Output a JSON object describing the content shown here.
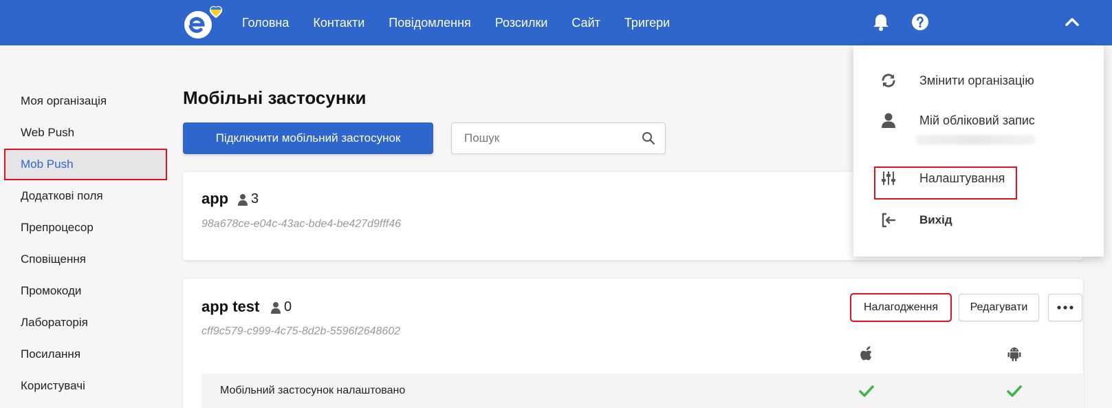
{
  "colors": {
    "primary": "#2f66cc",
    "highlight": "#e0111b",
    "success": "#3cb54a"
  },
  "header": {
    "logo_icon": "e-logo-heart-icon",
    "nav": [
      {
        "label": "Головна"
      },
      {
        "label": "Контакти"
      },
      {
        "label": "Повідомлення"
      },
      {
        "label": "Розсилки"
      },
      {
        "label": "Сайт"
      },
      {
        "label": "Тригери"
      }
    ],
    "icons": [
      "bell-icon",
      "help-icon",
      "chevron-up-icon"
    ]
  },
  "sidebar": {
    "items": [
      {
        "label": "Моя організація"
      },
      {
        "label": "Web Push"
      },
      {
        "label": "Mob Push"
      },
      {
        "label": "Додаткові поля"
      },
      {
        "label": "Препроцесор"
      },
      {
        "label": "Сповіщення"
      },
      {
        "label": "Промокоди"
      },
      {
        "label": "Лабораторія"
      },
      {
        "label": "Посилання"
      },
      {
        "label": "Користувачі"
      }
    ],
    "active": "Mob Push"
  },
  "main": {
    "title": "Мобільні застосунки",
    "connect_button": "Підключити мобільний застосунок",
    "search": {
      "placeholder": "Пошук",
      "value": ""
    },
    "apps": [
      {
        "name": "app",
        "users": "3",
        "id": "98a678ce-e04c-43ac-bde4-be427d9fff46"
      },
      {
        "name": "app test",
        "users": "0",
        "id": "cff9c579-c999-4c75-8d2b-5596f2648602",
        "buttons": {
          "debug": "Налагодження",
          "edit": "Редагувати",
          "more": "more-icon"
        },
        "platforms": [
          "apple-icon",
          "android-icon"
        ],
        "status": {
          "label": "Мобільний застосунок налаштовано",
          "ios": true,
          "android": true
        }
      }
    ]
  },
  "dropdown": {
    "items": [
      {
        "label": "Змінити організацію",
        "icon": "sync-icon"
      },
      {
        "label": "Мій обліковий запис",
        "icon": "user-icon"
      },
      {
        "label": "Налаштування",
        "icon": "sliders-icon"
      },
      {
        "label": "Вихід",
        "icon": "sign-out-icon"
      }
    ]
  }
}
